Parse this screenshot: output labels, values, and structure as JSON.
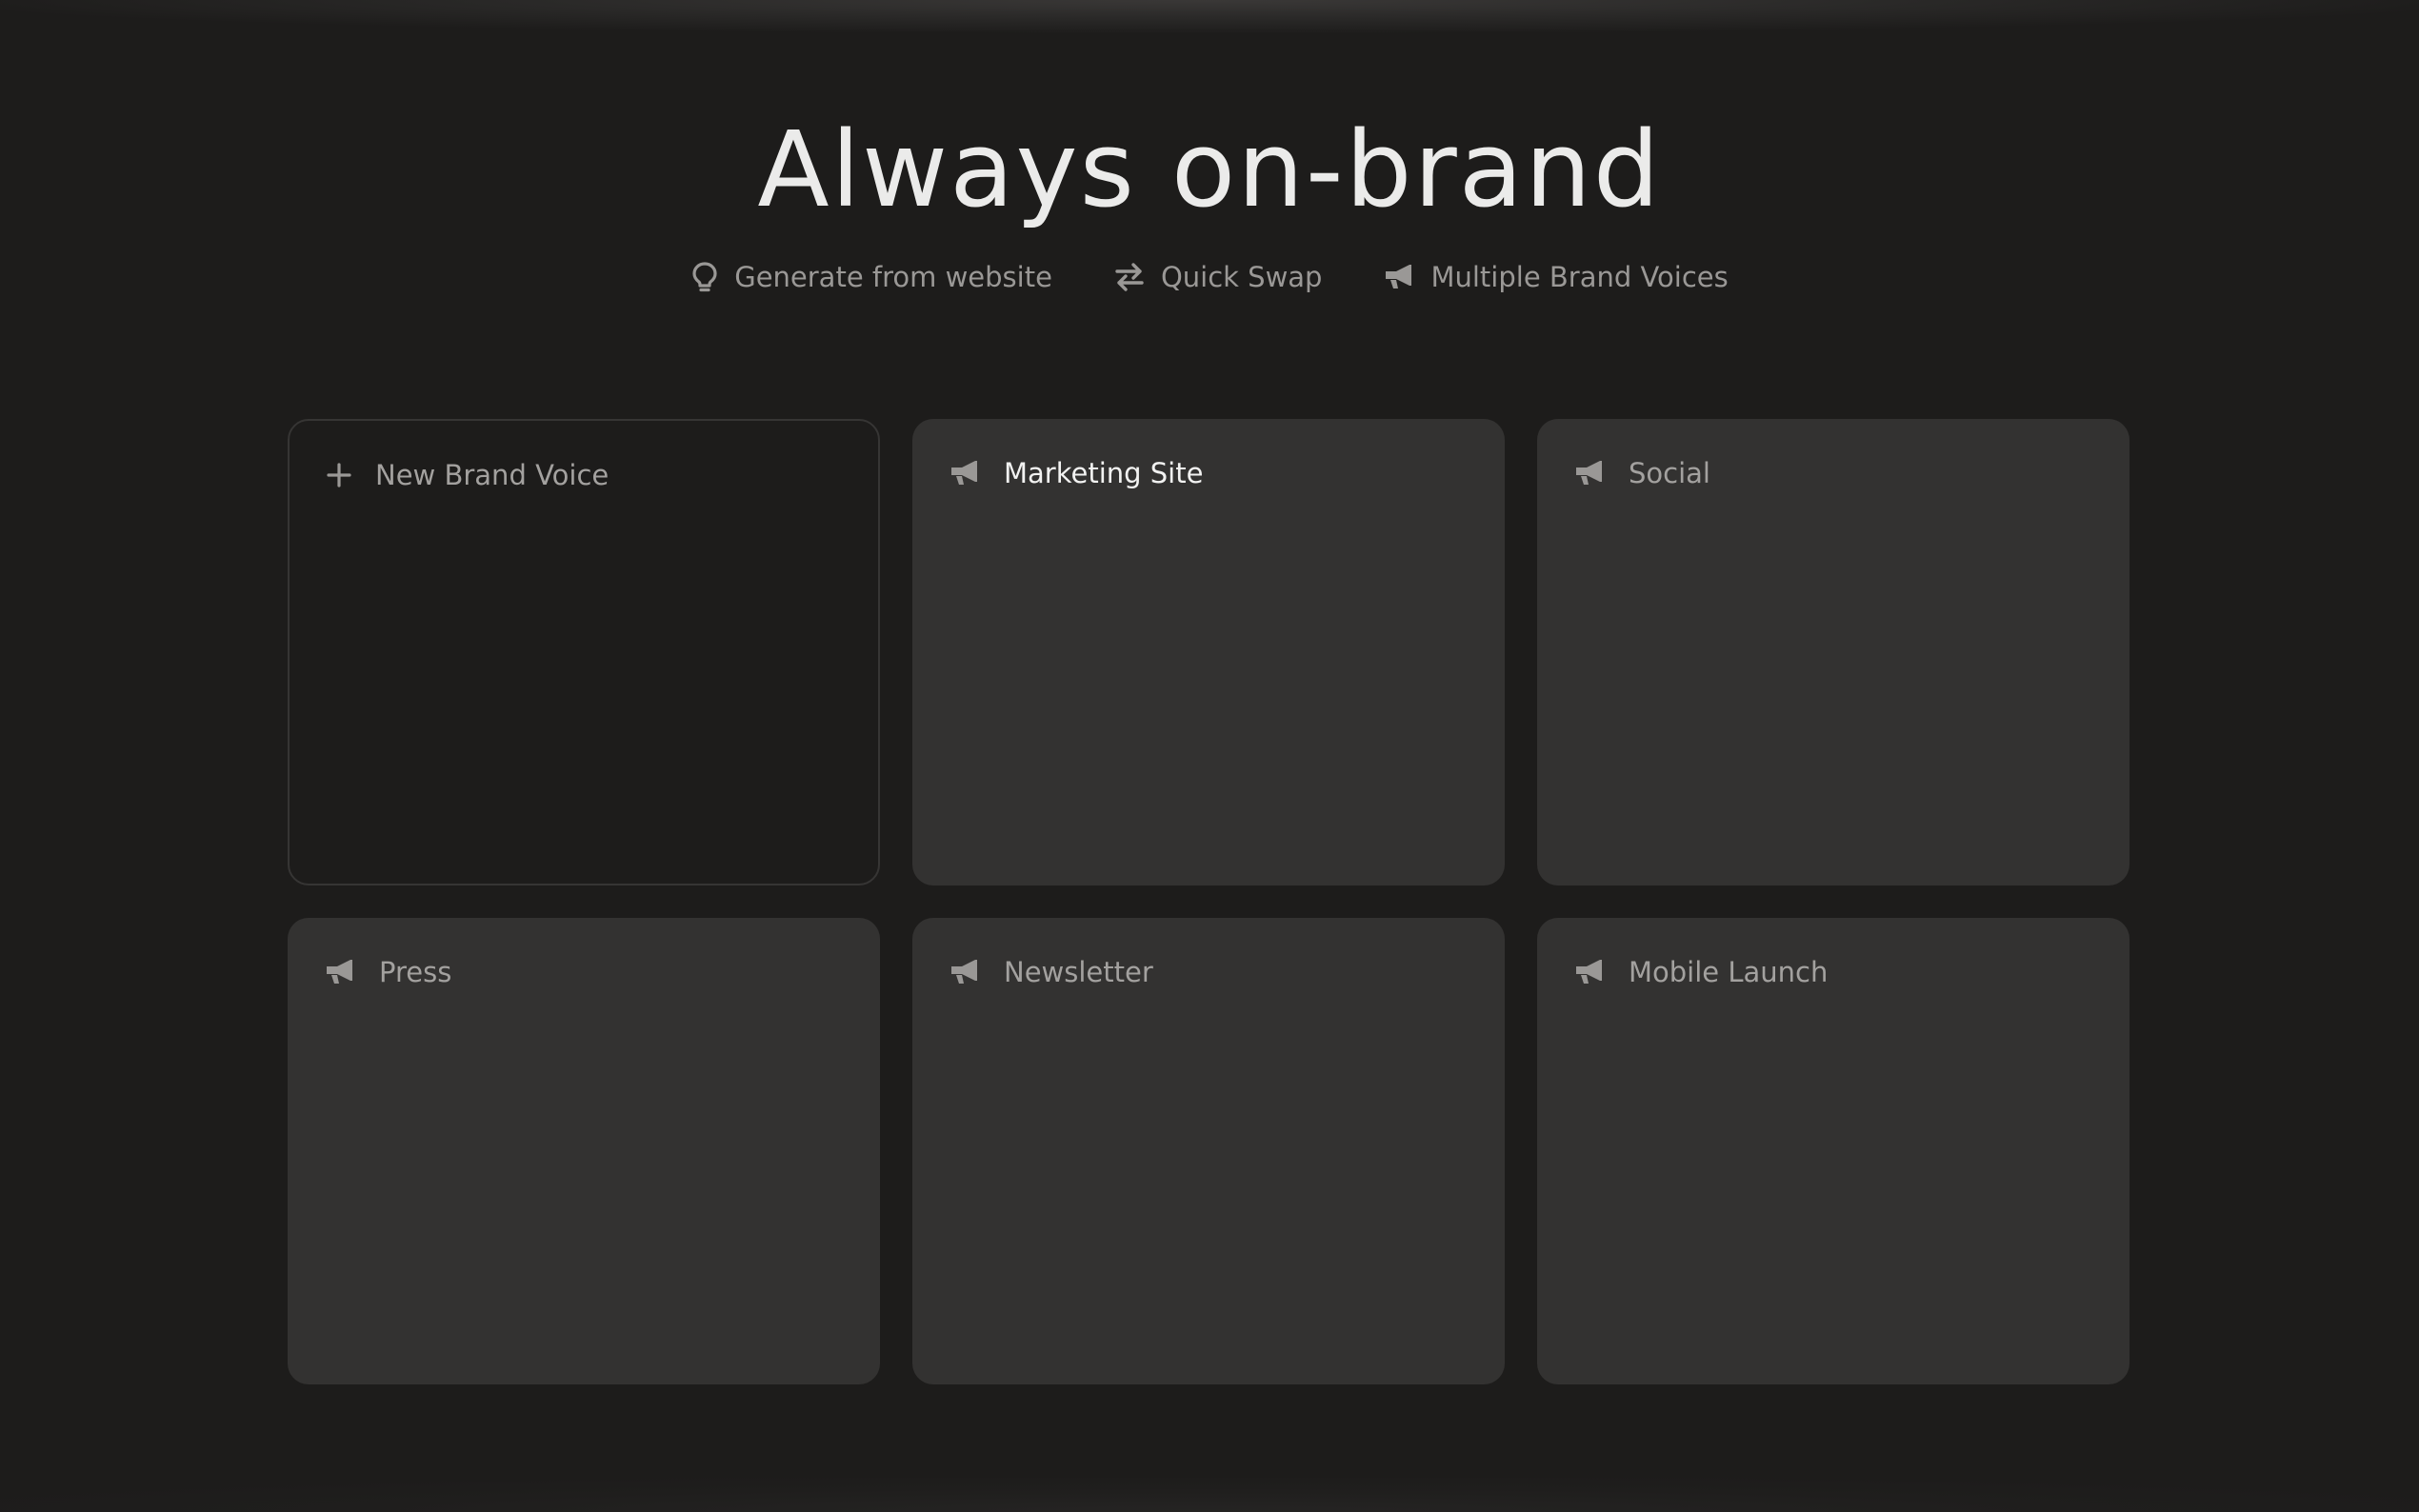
{
  "header": {
    "title": "Always on-brand"
  },
  "features": [
    {
      "icon": "lightbulb-icon",
      "label": "Generate from website"
    },
    {
      "icon": "swap-arrows-icon",
      "label": "Quick Swap"
    },
    {
      "icon": "megaphone-icon",
      "label": "Multiple Brand Voices"
    }
  ],
  "cards": [
    {
      "icon": "plus-icon",
      "label": "New Brand Voice"
    },
    {
      "icon": "megaphone-icon",
      "label": "Marketing Site"
    },
    {
      "icon": "megaphone-icon",
      "label": "Social"
    },
    {
      "icon": "megaphone-icon",
      "label": "Press"
    },
    {
      "icon": "megaphone-icon",
      "label": "Newsletter"
    },
    {
      "icon": "megaphone-icon",
      "label": "Mobile Launch"
    }
  ],
  "colors": {
    "background": "#1d1c1b",
    "card": "#333231",
    "title": "#ebebea",
    "muted_text": "#9a9896",
    "highlight_text": "#f2f2f1"
  }
}
